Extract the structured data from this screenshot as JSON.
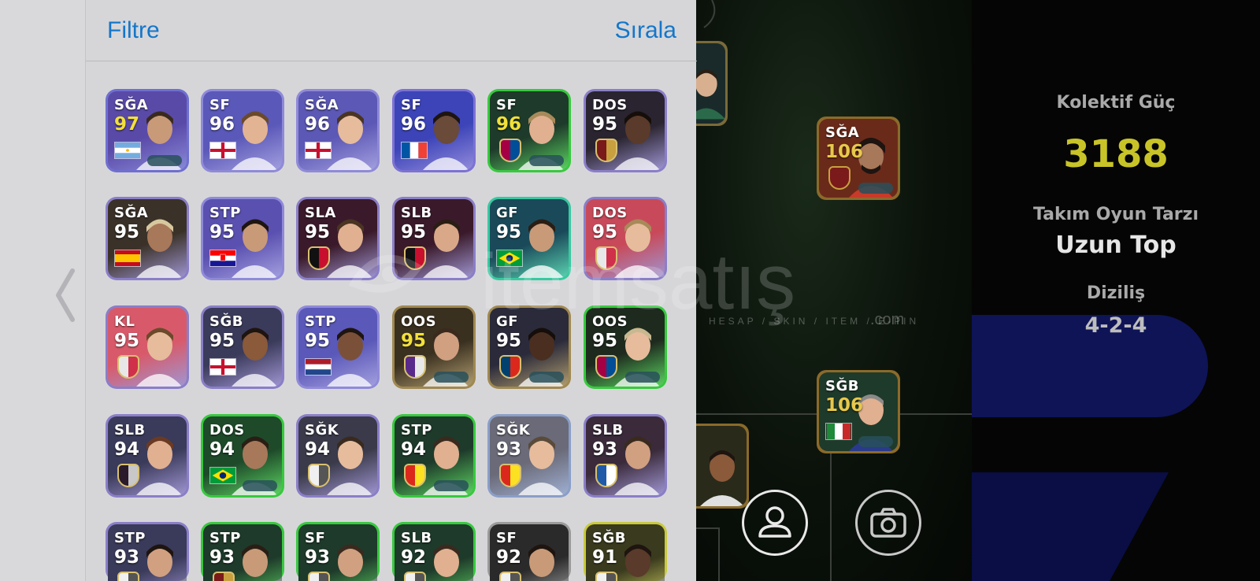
{
  "panel": {
    "filter_label": "Filtre",
    "sort_label": "Sırala"
  },
  "cards": [
    {
      "pos": "SĞA",
      "rating": "97",
      "gold": true,
      "bg": "#5a4aa8",
      "border": "#6f6fd0",
      "flag": "argentina",
      "player_tone": "#c89a78",
      "hair": "#3a2a1e"
    },
    {
      "pos": "SF",
      "rating": "96",
      "gold": false,
      "bg": "#5a58b8",
      "border": "#8f8ad8",
      "flag": "england",
      "player_tone": "#e2b494",
      "hair": "#6a4a2a"
    },
    {
      "pos": "SĞA",
      "rating": "96",
      "gold": false,
      "bg": "#5c58b5",
      "border": "#8f8ad8",
      "flag": "england",
      "player_tone": "#e6bc9c",
      "hair": "#4a3422"
    },
    {
      "pos": "SF",
      "rating": "96",
      "gold": false,
      "bg": "#3c44b8",
      "border": "#7c72d4",
      "flag": "france",
      "player_tone": "#6a4a38",
      "hair": "#1e1410"
    },
    {
      "pos": "SF",
      "rating": "96",
      "gold": true,
      "bg": "#1e3a2a",
      "border": "#37c93e",
      "flag": "crest-barca",
      "player_tone": "#e0b090",
      "hair": "#a88a5a"
    },
    {
      "pos": "DOS",
      "rating": "95",
      "gold": false,
      "bg": "#2a2430",
      "border": "#8a7ec8",
      "flag": "crest-red",
      "player_tone": "#5a3a2a",
      "hair": "#150e0a"
    },
    {
      "pos": "SĞA",
      "rating": "95",
      "gold": false,
      "bg": "#3a3228",
      "border": "#8a7ec8",
      "flag": "spain",
      "player_tone": "#a8785a",
      "hair": "#d8c8a0"
    },
    {
      "pos": "STP",
      "rating": "95",
      "gold": false,
      "bg": "#5a50b0",
      "border": "#8f8ad8",
      "flag": "croatia",
      "player_tone": "#c89a78",
      "hair": "#1e1410"
    },
    {
      "pos": "SLA",
      "rating": "95",
      "gold": false,
      "bg": "#3a1a2a",
      "border": "#8a7ec8",
      "flag": "crest-milan",
      "player_tone": "#e0b090",
      "hair": "#4a3422"
    },
    {
      "pos": "SLB",
      "rating": "95",
      "gold": false,
      "bg": "#3a1a2a",
      "border": "#8a7ec8",
      "flag": "crest-milan",
      "player_tone": "#d8a888",
      "hair": "#2a1e14"
    },
    {
      "pos": "GF",
      "rating": "95",
      "gold": false,
      "bg": "#1a4a5a",
      "border": "#37c9a0",
      "flag": "brazil",
      "player_tone": "#c89a78",
      "hair": "#2a1e14"
    },
    {
      "pos": "DOS",
      "rating": "95",
      "gold": false,
      "bg": "#c84a5a",
      "border": "#8a7ec8",
      "flag": "crest-pink",
      "player_tone": "#e6bc9c",
      "hair": "#a88a5a"
    },
    {
      "pos": "KL",
      "rating": "95",
      "gold": false,
      "bg": "#d85a6a",
      "border": "#8a7ec8",
      "flag": "crest-pink",
      "player_tone": "#e6bc9c",
      "hair": "#6a4a2a"
    },
    {
      "pos": "SĞB",
      "rating": "95",
      "gold": false,
      "bg": "#3a3a5a",
      "border": "#8a7ec8",
      "flag": "england",
      "player_tone": "#8a5a3a",
      "hair": "#1e1410"
    },
    {
      "pos": "STP",
      "rating": "95",
      "gold": false,
      "bg": "#5a58b8",
      "border": "#8f8ad8",
      "flag": "netherlands",
      "player_tone": "#7a5038",
      "hair": "#1e1410"
    },
    {
      "pos": "OOS",
      "rating": "95",
      "gold": true,
      "bg": "#3a3020",
      "border": "#a08850",
      "flag": "crest-purple",
      "player_tone": "#d0a080",
      "hair": "#3a2a1e"
    },
    {
      "pos": "GF",
      "rating": "95",
      "gold": false,
      "bg": "#2a2a3a",
      "border": "#a08850",
      "flag": "crest-psg",
      "player_tone": "#4a2e20",
      "hair": "#150e0a"
    },
    {
      "pos": "OOS",
      "rating": "95",
      "gold": false,
      "bg": "#1e2a1e",
      "border": "#37c93e",
      "flag": "crest-barca",
      "player_tone": "#e6bc9c",
      "hair": "#c8b890"
    },
    {
      "pos": "SLB",
      "rating": "94",
      "gold": false,
      "bg": "#3a3a5a",
      "border": "#8a7ec8",
      "flag": "crest-dark",
      "player_tone": "#e0b090",
      "hair": "#6a3a22"
    },
    {
      "pos": "DOS",
      "rating": "94",
      "gold": false,
      "bg": "#1e4a2a",
      "border": "#37c93e",
      "flag": "brazil",
      "player_tone": "#a8785a",
      "hair": "#2a1e14"
    },
    {
      "pos": "SĞK",
      "rating": "94",
      "gold": false,
      "bg": "#3a3a4a",
      "border": "#8a7ec8",
      "flag": "crest-white",
      "player_tone": "#e6bc9c",
      "hair": "#3a2a1e"
    },
    {
      "pos": "STP",
      "rating": "94",
      "gold": false,
      "bg": "#1e3a2a",
      "border": "#37c93e",
      "flag": "crest-manutd",
      "player_tone": "#e0b090",
      "hair": "#3a2a1e"
    },
    {
      "pos": "SĞK",
      "rating": "93",
      "gold": false,
      "bg": "#6a6a78",
      "border": "#8a9ec8",
      "flag": "crest-manutd",
      "player_tone": "#e6bc9c",
      "hair": "#5a4a3a"
    },
    {
      "pos": "SLB",
      "rating": "93",
      "gold": false,
      "bg": "#3a2a3a",
      "border": "#8a7ec8",
      "flag": "crest-blue",
      "player_tone": "#d0a080",
      "hair": "#3a2a1e"
    },
    {
      "pos": "STP",
      "rating": "93",
      "gold": false,
      "bg": "#3a3a5a",
      "border": "#8a7ec8",
      "flag": "crest-white",
      "player_tone": "#d0a080",
      "hair": "#1e1410"
    },
    {
      "pos": "STP",
      "rating": "93",
      "gold": false,
      "bg": "#1e3a2a",
      "border": "#37c93e",
      "flag": "crest-red",
      "player_tone": "#c89a78",
      "hair": "#2a1e14"
    },
    {
      "pos": "SF",
      "rating": "93",
      "gold": false,
      "bg": "#1e3a2a",
      "border": "#37c93e",
      "flag": "crest-white",
      "player_tone": "#d0a080",
      "hair": "#3a2a1e"
    },
    {
      "pos": "SLB",
      "rating": "92",
      "gold": false,
      "bg": "#1e3a2a",
      "border": "#37c93e",
      "flag": "crest-white",
      "player_tone": "#e0b090",
      "hair": "#3a2a1e"
    },
    {
      "pos": "SF",
      "rating": "92",
      "gold": false,
      "bg": "#2a2a2a",
      "border": "#9a9a9a",
      "flag": "crest-white",
      "player_tone": "#c89a78",
      "hair": "#1e1410"
    },
    {
      "pos": "SĞB",
      "rating": "91",
      "gold": false,
      "bg": "#3a3a1e",
      "border": "#c9c93e",
      "flag": "crest-white",
      "player_tone": "#5a3a2a",
      "hair": "#1e1410"
    }
  ],
  "field_cards": [
    {
      "pos": "SĞA",
      "rating": "106",
      "player_tone": "#a8785a",
      "hair": "#1e1410",
      "bg": "#6a2a1a"
    },
    {
      "pos": "SĞB",
      "rating": "106",
      "player_tone": "#e0b090",
      "hair": "#8a8a8a",
      "bg": "#1e3a2a"
    }
  ],
  "stats": {
    "collective_label": "Kolektif Güç",
    "collective_value": "3188",
    "style_label": "Takım Oyun Tarzı",
    "style_value": "Uzun Top",
    "formation_label": "Diziliş",
    "formation_value": "4-2-4"
  },
  "watermark": {
    "brand": "itemsatış",
    "tagline": "HESAP / SKIN / ITEM / E-PIN",
    "suffix": ".com"
  },
  "colors": {
    "accent": "#1576c9",
    "collective_value": "#c8c428"
  }
}
